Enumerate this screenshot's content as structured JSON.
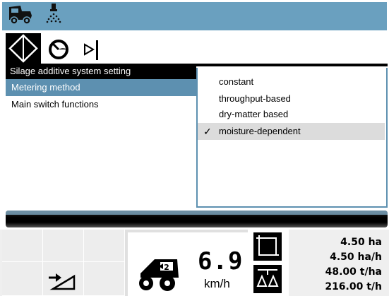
{
  "topbar": {
    "harvester_icon": "forage-harvester-icon",
    "additive_icon": "spray-nozzle-icon"
  },
  "toolbar": {
    "items": [
      "diamond-nav-icon",
      "speedometer-icon",
      "flag-marker-icon"
    ]
  },
  "panel": {
    "title": "Silage additive system setting",
    "menu": [
      {
        "label": "Metering method",
        "selected": true
      },
      {
        "label": "Main switch functions",
        "selected": false
      }
    ]
  },
  "dropdown": {
    "options": [
      {
        "label": "constant",
        "checked": false
      },
      {
        "label": "throughput-based",
        "checked": false
      },
      {
        "label": "dry-matter based",
        "checked": false
      },
      {
        "label": "moisture-dependent",
        "checked": true
      }
    ],
    "check_glyph": "✓"
  },
  "status": {
    "speed": "6.9",
    "speed_unit": "km/h",
    "stats": [
      "4.50 ha",
      "4.50 ha/h",
      "48.00 t/ha",
      "216.00 t/h"
    ]
  },
  "colors": {
    "accent": "#5d90b0",
    "topbar": "#6aa0bf"
  }
}
